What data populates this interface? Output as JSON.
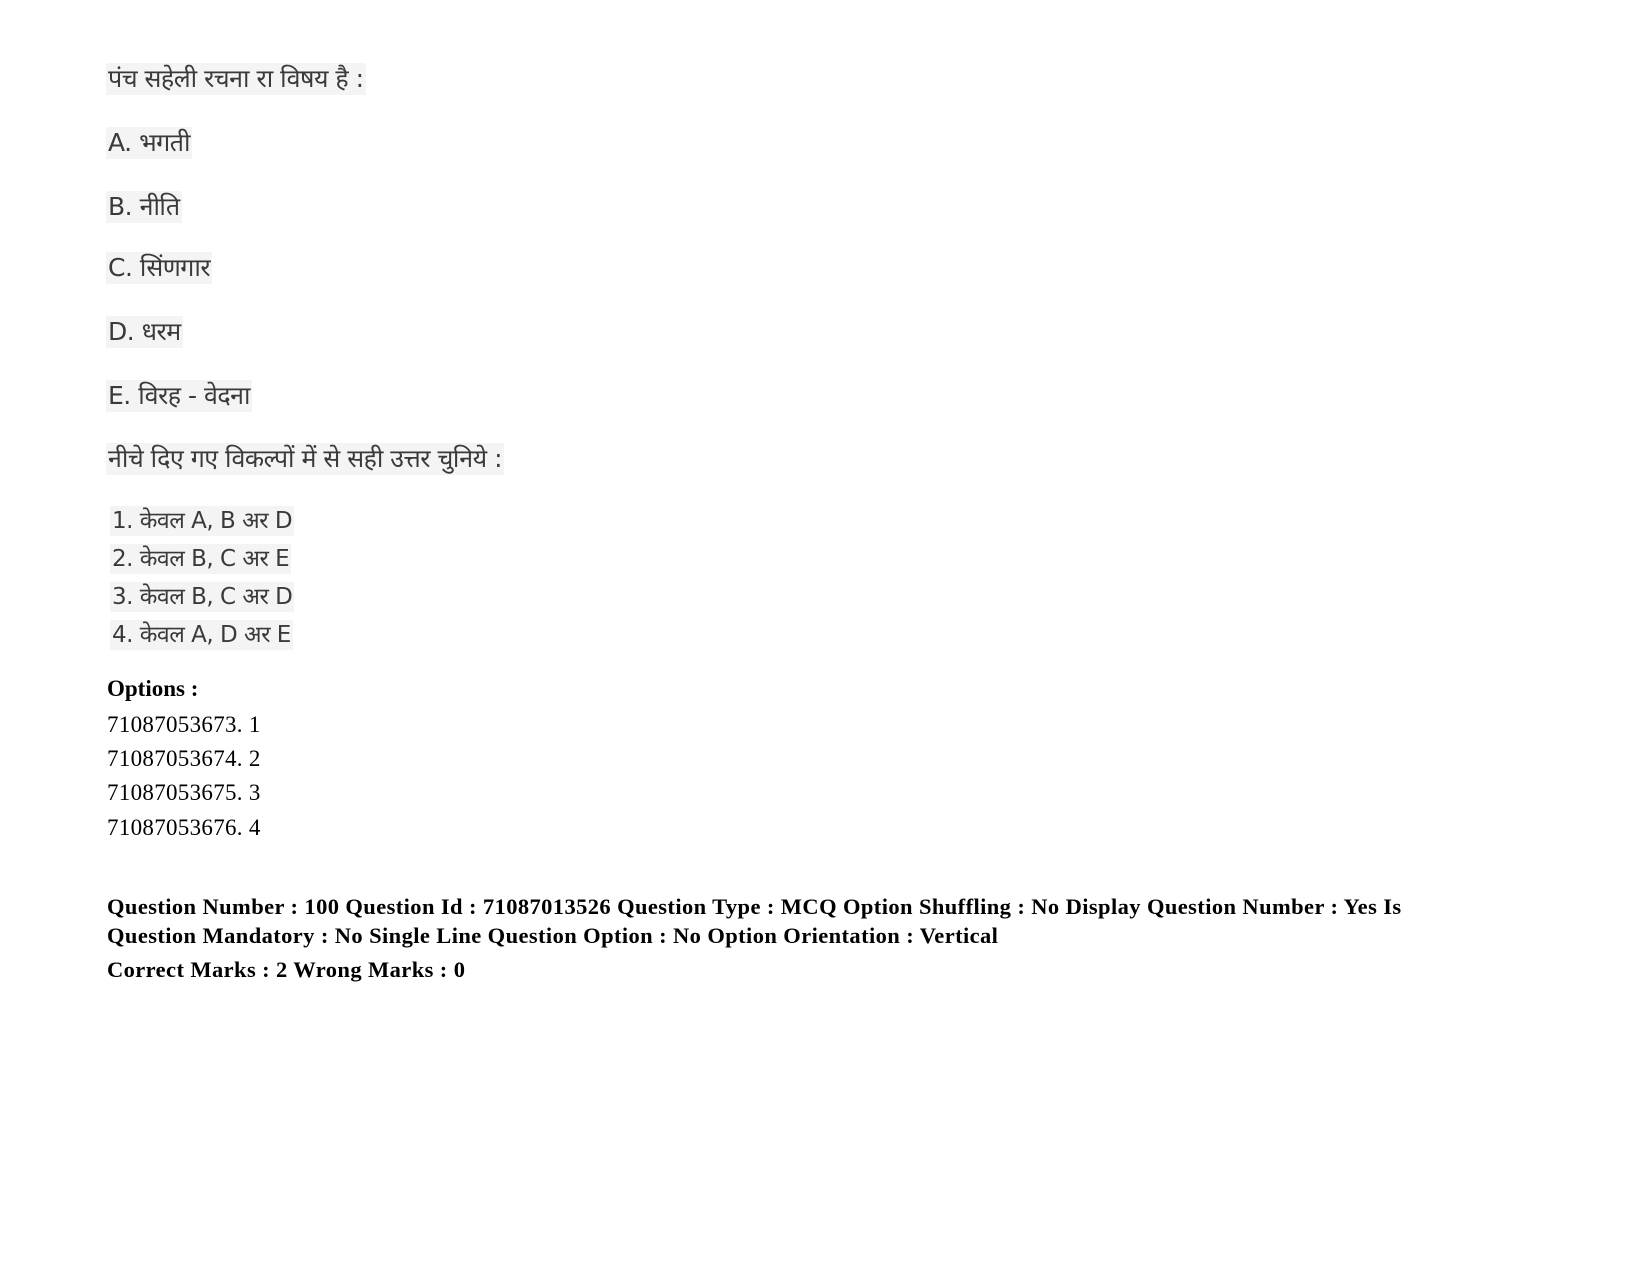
{
  "question": {
    "stem": "पंच सहेली रचना रा विषय है :",
    "statements": [
      {
        "label": "A.",
        "text": "भगती"
      },
      {
        "label": "B.",
        "text": "नीति"
      },
      {
        "label": "C.",
        "text": "सिंणगार"
      },
      {
        "label": "D.",
        "text": "धरम"
      },
      {
        "label": "E.",
        "text": "विरह - वेदना"
      }
    ],
    "instruction": "नीचे दिए गए विकल्पों में से सही उत्तर चुनिये :",
    "choices": [
      {
        "num": "1.",
        "text": "केवल A, B अर D"
      },
      {
        "num": "2.",
        "text": "केवल B, C अर E"
      },
      {
        "num": "3.",
        "text": "केवल B, C अर D"
      },
      {
        "num": "4.",
        "text": "केवल A, D अर E"
      }
    ]
  },
  "options": {
    "heading": "Options :",
    "items": [
      "71087053673. 1",
      "71087053674. 2",
      "71087053675. 3",
      "71087053676. 4"
    ]
  },
  "next_question_meta": {
    "line1": "Question Number : 100 Question Id : 71087013526 Question Type : MCQ Option Shuffling : No Display Question Number : Yes Is",
    "line2": "Question Mandatory : No Single Line Question Option : No Option Orientation : Vertical",
    "marks": "Correct Marks : 2 Wrong Marks : 0"
  }
}
